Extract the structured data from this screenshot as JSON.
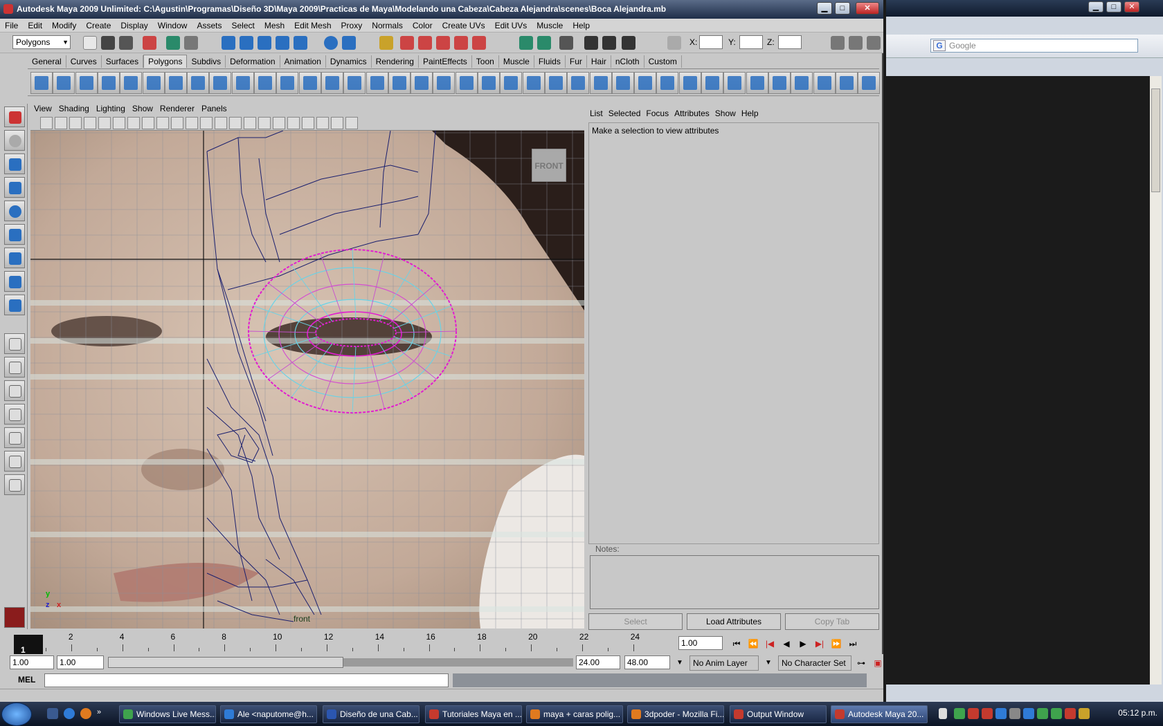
{
  "browser": {
    "search_placeholder": "Google",
    "google_logo": "G"
  },
  "maya": {
    "title": "Autodesk Maya 2009 Unlimited: C:\\Agustin\\Programas\\Diseño 3D\\Maya 2009\\Practicas de Maya\\Modelando una Cabeza\\Cabeza Alejandra\\scenes\\Boca Alejandra.mb",
    "window_buttons": {
      "minimize": "▁",
      "maximize": "□",
      "close": "✕"
    },
    "menus": [
      "File",
      "Edit",
      "Modify",
      "Create",
      "Display",
      "Window",
      "Assets",
      "Select",
      "Mesh",
      "Edit Mesh",
      "Proxy",
      "Normals",
      "Color",
      "Create UVs",
      "Edit UVs",
      "Muscle",
      "Help"
    ],
    "mode": "Polygons",
    "coords": {
      "x_label": "X:",
      "y_label": "Y:",
      "z_label": "Z:"
    },
    "shelf_tabs": [
      "General",
      "Curves",
      "Surfaces",
      "Polygons",
      "Subdivs",
      "Deformation",
      "Animation",
      "Dynamics",
      "Rendering",
      "PaintEffects",
      "Toon",
      "Muscle",
      "Fluids",
      "Fur",
      "Hair",
      "nCloth",
      "Custom"
    ],
    "active_shelf_tab": "Polygons",
    "panel_menus": [
      "View",
      "Shading",
      "Lighting",
      "Show",
      "Renderer",
      "Panels"
    ],
    "viewport": {
      "cube_label": "FRONT",
      "camera_label": "front",
      "axis": {
        "y": "y",
        "z": "z",
        "x": "x"
      }
    },
    "attr_menus": [
      "List",
      "Selected",
      "Focus",
      "Attributes",
      "Show",
      "Help"
    ],
    "attr_message": "Make a selection to view attributes",
    "notes_label": "Notes:",
    "buttons": {
      "select": "Select",
      "load": "Load Attributes",
      "copy": "Copy Tab"
    },
    "timeline": {
      "current_frame": "1",
      "ticks": [
        "2",
        "4",
        "6",
        "8",
        "10",
        "12",
        "14",
        "16",
        "18",
        "20",
        "22",
        "24"
      ],
      "current_field": "1.00"
    },
    "playback_buttons": [
      "⏮",
      "⏪",
      "|◀",
      "◀",
      "▶",
      "▶|",
      "⏩",
      "⏭"
    ],
    "range": {
      "start": "1.00",
      "playstart": "1.00",
      "playend": "24.00",
      "end": "48.00",
      "anim_layer": "No Anim Layer",
      "char_set": "No Character Set"
    },
    "mel_label": "MEL"
  },
  "taskbar": {
    "items": [
      {
        "label": "Windows Live Mess...",
        "color": "#3fa34d"
      },
      {
        "label": "Ale <naputome@h...",
        "color": "#2f7bd6"
      },
      {
        "label": "Diseño de una Cab...",
        "color": "#2b56b0"
      },
      {
        "label": "Tutoriales Maya en ...",
        "color": "#c43a2e"
      },
      {
        "label": "maya + caras polig...",
        "color": "#e07a1f"
      },
      {
        "label": "3dpoder - Mozilla Fi...",
        "color": "#e07a1f"
      },
      {
        "label": "Output Window",
        "color": "#c43a2e"
      },
      {
        "label": "Autodesk Maya 20...",
        "color": "#c43a2e"
      }
    ],
    "clock": "05:12 p.m."
  }
}
